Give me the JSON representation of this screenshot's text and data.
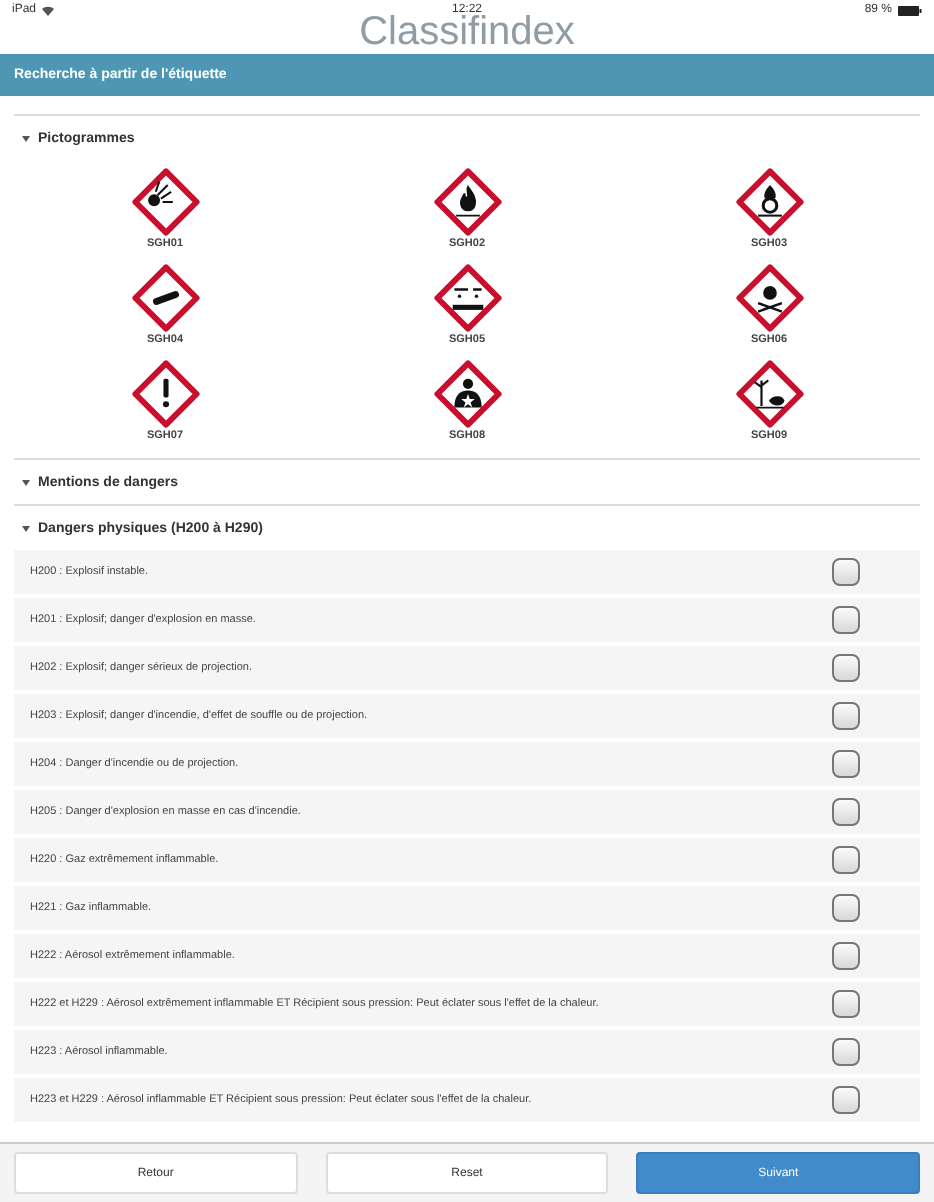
{
  "status_bar": {
    "device": "iPad",
    "time": "12:22",
    "battery": "89 %"
  },
  "app_title": "Classifindex",
  "header": {
    "title": "Recherche à partir de l'étiquette"
  },
  "pictograms_section": {
    "title": "Pictogrammes",
    "expanded": true,
    "items": [
      {
        "label": "SGH01"
      },
      {
        "label": "SGH02"
      },
      {
        "label": "SGH03"
      },
      {
        "label": "SGH04"
      },
      {
        "label": "SGH05"
      },
      {
        "label": "SGH06"
      },
      {
        "label": "SGH07"
      },
      {
        "label": "SGH08"
      },
      {
        "label": "SGH09"
      }
    ]
  },
  "mentions_section": {
    "title": "Mentions de dangers",
    "expanded": true
  },
  "physical_section": {
    "title": "Dangers physiques (H200 à H290)",
    "expanded": true,
    "rows": [
      {
        "text": "H200 : Explosif instable.",
        "checked": false
      },
      {
        "text": "H201 : Explosif; danger d'explosion en masse.",
        "checked": false
      },
      {
        "text": "H202 : Explosif; danger sérieux de projection.",
        "checked": false
      },
      {
        "text": "H203 : Explosif; danger d'incendie, d'effet de souffle ou de projection.",
        "checked": false
      },
      {
        "text": "H204 : Danger d'incendie ou de projection.",
        "checked": false
      },
      {
        "text": "H205 : Danger d'explosion en masse en cas d'incendie.",
        "checked": false
      },
      {
        "text": "H220 : Gaz extrêmement inflammable.",
        "checked": false
      },
      {
        "text": "H221 : Gaz inflammable.",
        "checked": false
      },
      {
        "text": "H222 : Aérosol extrêmement inflammable.",
        "checked": false
      },
      {
        "text": "H222 et H229 : Aérosol extrêmement inflammable ET Récipient sous pression: Peut éclater sous l'effet de la chaleur.",
        "checked": false
      },
      {
        "text": "H223 : Aérosol inflammable.",
        "checked": false
      },
      {
        "text": "H223 et H229 : Aérosol inflammable ET Récipient sous pression: Peut éclater sous l'effet de la chaleur.",
        "checked": false
      }
    ]
  },
  "footer": {
    "buttons": [
      {
        "label": "Retour",
        "kind": "default"
      },
      {
        "label": "Reset",
        "kind": "default"
      },
      {
        "label": "Suivant",
        "kind": "primary"
      }
    ]
  }
}
